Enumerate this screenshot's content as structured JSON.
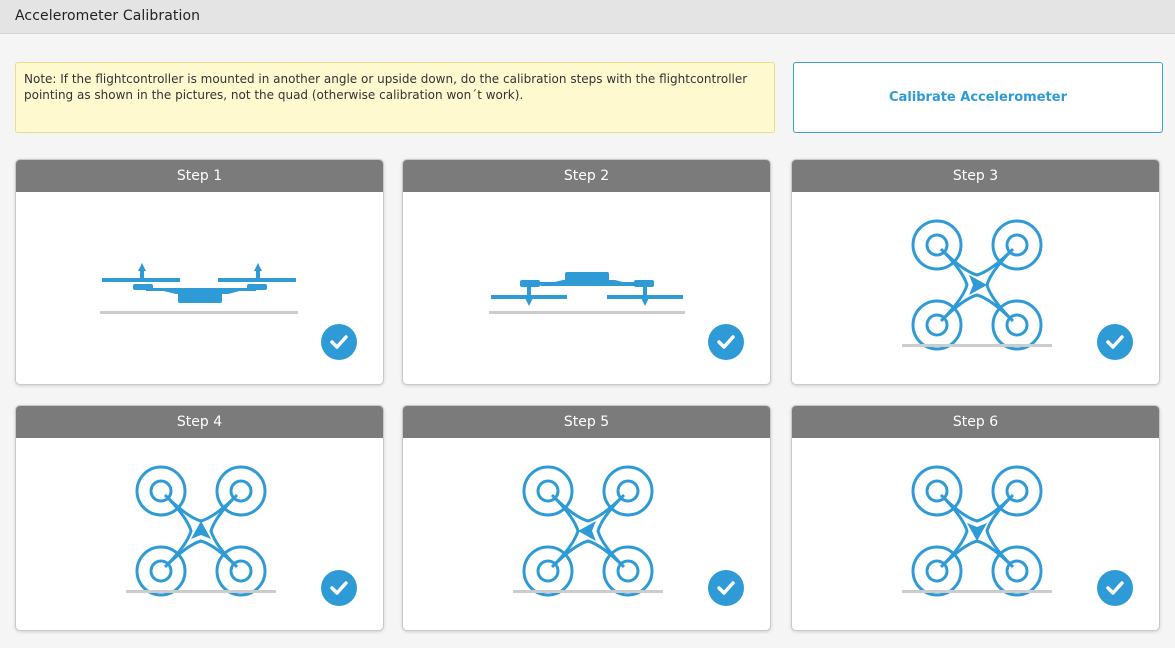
{
  "header": {
    "title": "Accelerometer Calibration"
  },
  "note": {
    "text": "Note: If the flightcontroller is mounted in another angle or upside down, do the calibration steps with the flightcontroller pointing as shown in the pictures, not the quad (otherwise calibration won´t work)."
  },
  "calibrate_button": {
    "label": "Calibrate Accelerometer"
  },
  "colors": {
    "accent": "#2e9bd6",
    "card_header": "#7b7b7b",
    "note_bg": "#fff9d0"
  },
  "steps": [
    {
      "label": "Step 1",
      "orientation": "level-side-view",
      "done": true
    },
    {
      "label": "Step 2",
      "orientation": "upside-down-side-view",
      "done": true
    },
    {
      "label": "Step 3",
      "orientation": "top-view-arrow-right",
      "done": true
    },
    {
      "label": "Step 4",
      "orientation": "top-view-arrow-up",
      "done": true
    },
    {
      "label": "Step 5",
      "orientation": "top-view-arrow-left",
      "done": true
    },
    {
      "label": "Step 6",
      "orientation": "top-view-arrow-down",
      "done": true
    }
  ]
}
